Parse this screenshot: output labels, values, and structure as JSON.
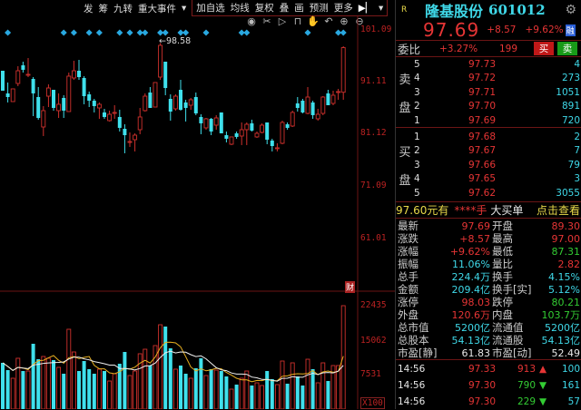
{
  "toolbar": {
    "items": [
      "发",
      "筹",
      "九转",
      "重大事件"
    ],
    "dropdown": "▾",
    "items2": [
      "加自选",
      "均线",
      "复权",
      "叠",
      "画",
      "预测",
      "更多"
    ],
    "more_icon": "▶▏",
    "more_dropdown": "▾"
  },
  "tools": [
    {
      "name": "eye-icon",
      "glyph": "◉"
    },
    {
      "name": "scissors-icon",
      "glyph": "✂"
    },
    {
      "name": "play-icon",
      "glyph": "▷"
    },
    {
      "name": "lock-icon",
      "glyph": "⊓"
    },
    {
      "name": "hand-icon",
      "glyph": "✋"
    },
    {
      "name": "undo-icon",
      "glyph": "↶"
    },
    {
      "name": "zoom-in-icon",
      "glyph": "⊕"
    },
    {
      "name": "zoom-out-icon",
      "glyph": "⊖"
    }
  ],
  "chart_data": {
    "type": "candlestick",
    "price_axis": {
      "ticks": [
        "101.09",
        "91.11",
        "81.12",
        "71.09",
        "61.01"
      ],
      "values": [
        101.09,
        91.11,
        81.12,
        71.09,
        61.01
      ]
    },
    "high_marker": "98.58",
    "event_badge": "财",
    "volume_axis": {
      "ticks": [
        "22435",
        "15062",
        "7531",
        "X100"
      ],
      "values": [
        22435,
        15062,
        7531,
        0
      ]
    },
    "event_candles": [
      1,
      12,
      14,
      17,
      19,
      23,
      25,
      27,
      28,
      31,
      32,
      35,
      36,
      40,
      47,
      48,
      60,
      66,
      67
    ],
    "candles": [
      [
        93.25,
        89.42,
        93.25,
        89.42
      ],
      [
        88.9,
        88.2,
        90.99,
        87.16
      ],
      [
        87.33,
        89.77,
        89.77,
        87.33
      ],
      [
        90.81,
        93.25,
        94.12,
        90.29
      ],
      [
        94.3,
        93.43,
        94.99,
        92.9
      ],
      [
        92.56,
        92.56,
        95.69,
        92.03
      ],
      [
        91.68,
        88.9,
        92.03,
        84.54
      ],
      [
        88.2,
        84.19,
        90.12,
        83.85
      ],
      [
        82.45,
        85.59,
        86.46,
        80.71
      ],
      [
        88.37,
        89.94,
        90.64,
        86.28
      ],
      [
        89.59,
        86.11,
        89.59,
        85.59
      ],
      [
        85.59,
        86.81,
        88.9,
        84.19
      ],
      [
        88.03,
        85.59,
        88.55,
        84.19
      ],
      [
        85.41,
        92.21,
        92.9,
        85.41
      ],
      [
        91.86,
        93.25,
        95.17,
        91.51
      ],
      [
        93.25,
        92.03,
        95.34,
        91.51
      ],
      [
        91.86,
        88.37,
        92.21,
        86.81
      ],
      [
        88.72,
        87.5,
        89.25,
        86.28
      ],
      [
        87.5,
        86.46,
        87.85,
        85.24
      ],
      [
        86.11,
        86.81,
        87.16,
        84.02
      ],
      [
        85.24,
        84.37,
        85.94,
        84.02
      ],
      [
        83.67,
        84.89,
        85.59,
        83.5
      ],
      [
        85.24,
        85.24,
        86.63,
        84.02
      ],
      [
        84.37,
        82.28,
        85.76,
        81.58
      ],
      [
        82.1,
        80.88,
        82.97,
        77.4
      ],
      [
        79.66,
        79.66,
        81.41,
        78.62
      ],
      [
        80.01,
        80.88,
        81.23,
        77.75
      ],
      [
        81.93,
        84.37,
        86.11,
        81.06
      ],
      [
        85.59,
        88.37,
        88.9,
        85.41
      ],
      [
        89.07,
        86.11,
        90.12,
        86.11
      ],
      [
        86.28,
        90.99,
        90.99,
        86.28
      ],
      [
        92.03,
        98.13,
        98.58,
        91.51
      ],
      [
        94.99,
        89.94,
        94.99,
        88.55
      ],
      [
        87.85,
        85.41,
        88.72,
        83.67
      ],
      [
        85.94,
        88.37,
        88.72,
        85.59
      ],
      [
        89.59,
        85.76,
        91.51,
        85.59
      ],
      [
        87.16,
        86.11,
        87.68,
        83.5
      ],
      [
        86.63,
        87.68,
        88.03,
        85.76
      ],
      [
        88.2,
        85.06,
        89.07,
        84.72
      ],
      [
        84.37,
        83.15,
        84.89,
        81.06
      ],
      [
        82.28,
        84.02,
        84.19,
        81.93
      ],
      [
        84.02,
        81.58,
        84.19,
        80.88
      ],
      [
        82.8,
        84.19,
        84.72,
        81.93
      ],
      [
        85.24,
        81.23,
        85.24,
        81.23
      ],
      [
        80.88,
        80.19,
        81.58,
        79.49
      ],
      [
        79.14,
        80.54,
        80.54,
        78.97
      ],
      [
        81.23,
        80.54,
        81.58,
        80.19
      ],
      [
        80.71,
        81.93,
        83.32,
        78.97
      ],
      [
        81.93,
        82.97,
        83.32,
        78.97
      ],
      [
        83.15,
        81.76,
        83.85,
        81.58
      ],
      [
        80.54,
        81.23,
        81.58,
        80.36
      ],
      [
        81.41,
        82.8,
        83.15,
        81.23
      ],
      [
        83.32,
        80.01,
        83.32,
        79.14
      ],
      [
        79.84,
        78.79,
        80.19,
        77.75
      ],
      [
        78.45,
        78.45,
        79.32,
        77.75
      ],
      [
        79.32,
        83.32,
        83.67,
        79.14
      ],
      [
        82.97,
        82.28,
        83.32,
        81.93
      ],
      [
        82.63,
        85.24,
        85.59,
        82.45
      ],
      [
        86.98,
        86.11,
        88.2,
        85.41
      ],
      [
        87.5,
        85.24,
        87.85,
        85.06
      ],
      [
        85.06,
        88.2,
        90.12,
        84.89
      ],
      [
        87.16,
        84.72,
        87.5,
        84.02
      ],
      [
        84.02,
        84.89,
        85.94,
        83.67
      ],
      [
        85.06,
        88.2,
        88.37,
        84.72
      ],
      [
        88.9,
        86.63,
        89.59,
        86.63
      ],
      [
        86.98,
        88.55,
        89.42,
        86.63
      ],
      [
        89.25,
        89.25,
        89.77,
        87.68
      ],
      [
        89.12,
        97.69,
        97.96,
        87.68
      ]
    ],
    "volumes": [
      10140,
      8530,
      6730,
      11150,
      8330,
      8330,
      14360,
      10940,
      11550,
      11150,
      10740,
      9140,
      7730,
      17570,
      12550,
      8330,
      10540,
      8740,
      7730,
      8740,
      8330,
      6120,
      7730,
      9940,
      12550,
      7330,
      8330,
      12150,
      13150,
      9540,
      13960,
      18570,
      18170,
      13350,
      8740,
      9540,
      7730,
      6730,
      8940,
      11150,
      7330,
      8740,
      8530,
      8330,
      7130,
      4320,
      5320,
      6730,
      8330,
      5120,
      5720,
      5120,
      8330,
      6530,
      5320,
      10540,
      5520,
      10140,
      7130,
      5120,
      10940,
      8740,
      5720,
      10140,
      6120,
      9540,
      9540,
      22790
    ]
  },
  "quote": {
    "badge": "R",
    "name": "隆基股份",
    "code": "601012",
    "price": "97.69",
    "change": "+8.57",
    "pct": "+9.62%",
    "tag": "融",
    "settings_icon": "⚙"
  },
  "weibi": {
    "label": "委比",
    "pct": "+3.27%",
    "diff": "199",
    "buy": "买",
    "sell": "卖"
  },
  "sell": {
    "label1": "卖",
    "label2": "盘",
    "rows": [
      {
        "lv": "5",
        "price": "97.73",
        "vol": "4"
      },
      {
        "lv": "4",
        "price": "97.72",
        "vol": "273"
      },
      {
        "lv": "3",
        "price": "97.71",
        "vol": "1051"
      },
      {
        "lv": "2",
        "price": "97.70",
        "vol": "891"
      },
      {
        "lv": "1",
        "price": "97.69",
        "vol": "720"
      }
    ]
  },
  "buy": {
    "label1": "买",
    "label2": "盘",
    "rows": [
      {
        "lv": "1",
        "price": "97.68",
        "vol": "2"
      },
      {
        "lv": "2",
        "price": "97.67",
        "vol": "7"
      },
      {
        "lv": "3",
        "price": "97.66",
        "vol": "79"
      },
      {
        "lv": "4",
        "price": "97.65",
        "vol": "3"
      },
      {
        "lv": "5",
        "price": "97.62",
        "vol": "3055"
      }
    ]
  },
  "bigorder": {
    "a": "97.60元有",
    "b": "****手",
    "c": "大买单",
    "d": "点击查看"
  },
  "stats": [
    {
      "k": "最新",
      "v": "97.69",
      "vc": "red",
      "k2": "开盘",
      "v2": "89.30",
      "v2c": "red"
    },
    {
      "k": "涨跌",
      "v": "+8.57",
      "vc": "red",
      "k2": "最高",
      "v2": "97.00",
      "v2c": "red"
    },
    {
      "k": "涨幅",
      "v": "+9.62%",
      "vc": "red",
      "k2": "最低",
      "v2": "87.31",
      "v2c": "green"
    },
    {
      "k": "振幅",
      "v": "11.06%",
      "vc": "cyan",
      "k2": "量比",
      "v2": "2.82",
      "v2c": "red"
    },
    {
      "k": "总手",
      "v": "224.4万",
      "vc": "cyan",
      "k2": "换手",
      "v2": "4.15%",
      "v2c": "cyan"
    },
    {
      "k": "金额",
      "v": "209.4亿",
      "vc": "cyan",
      "k2": "换手[实]",
      "v2": "5.12%",
      "v2c": "cyan"
    },
    {
      "k": "涨停",
      "v": "98.03",
      "vc": "red",
      "k2": "跌停",
      "v2": "80.21",
      "v2c": "green"
    },
    {
      "k": "外盘",
      "v": "120.6万",
      "vc": "red",
      "k2": "内盘",
      "v2": "103.7万",
      "v2c": "green"
    },
    {
      "k": "总市值",
      "v": "5200亿",
      "vc": "cyan",
      "k2": "流通值",
      "v2": "5200亿",
      "v2c": "cyan"
    },
    {
      "k": "总股本",
      "v": "54.13亿",
      "vc": "cyan",
      "k2": "流通股",
      "v2": "54.13亿",
      "v2c": "cyan"
    },
    {
      "k": "市盈[静]",
      "v": "61.83",
      "vc": "white",
      "k2": "市盈[动]",
      "v2": "52.49",
      "v2c": "white"
    }
  ],
  "trades": [
    {
      "t": "14:56",
      "p": "97.33",
      "v": "913",
      "vc": "red",
      "dir": "▲",
      "n": "100"
    },
    {
      "t": "14:56",
      "p": "97.30",
      "v": "790",
      "vc": "green",
      "dir": "▼",
      "n": "161"
    },
    {
      "t": "14:56",
      "p": "97.30",
      "v": "229",
      "vc": "green",
      "dir": "▼",
      "n": "57"
    }
  ],
  "colors": {
    "up": "#d0312d",
    "down": "#3fe0ec",
    "marker": "#29a8e0",
    "ma5": "#f0f0f0",
    "ma10": "#e8b020"
  }
}
